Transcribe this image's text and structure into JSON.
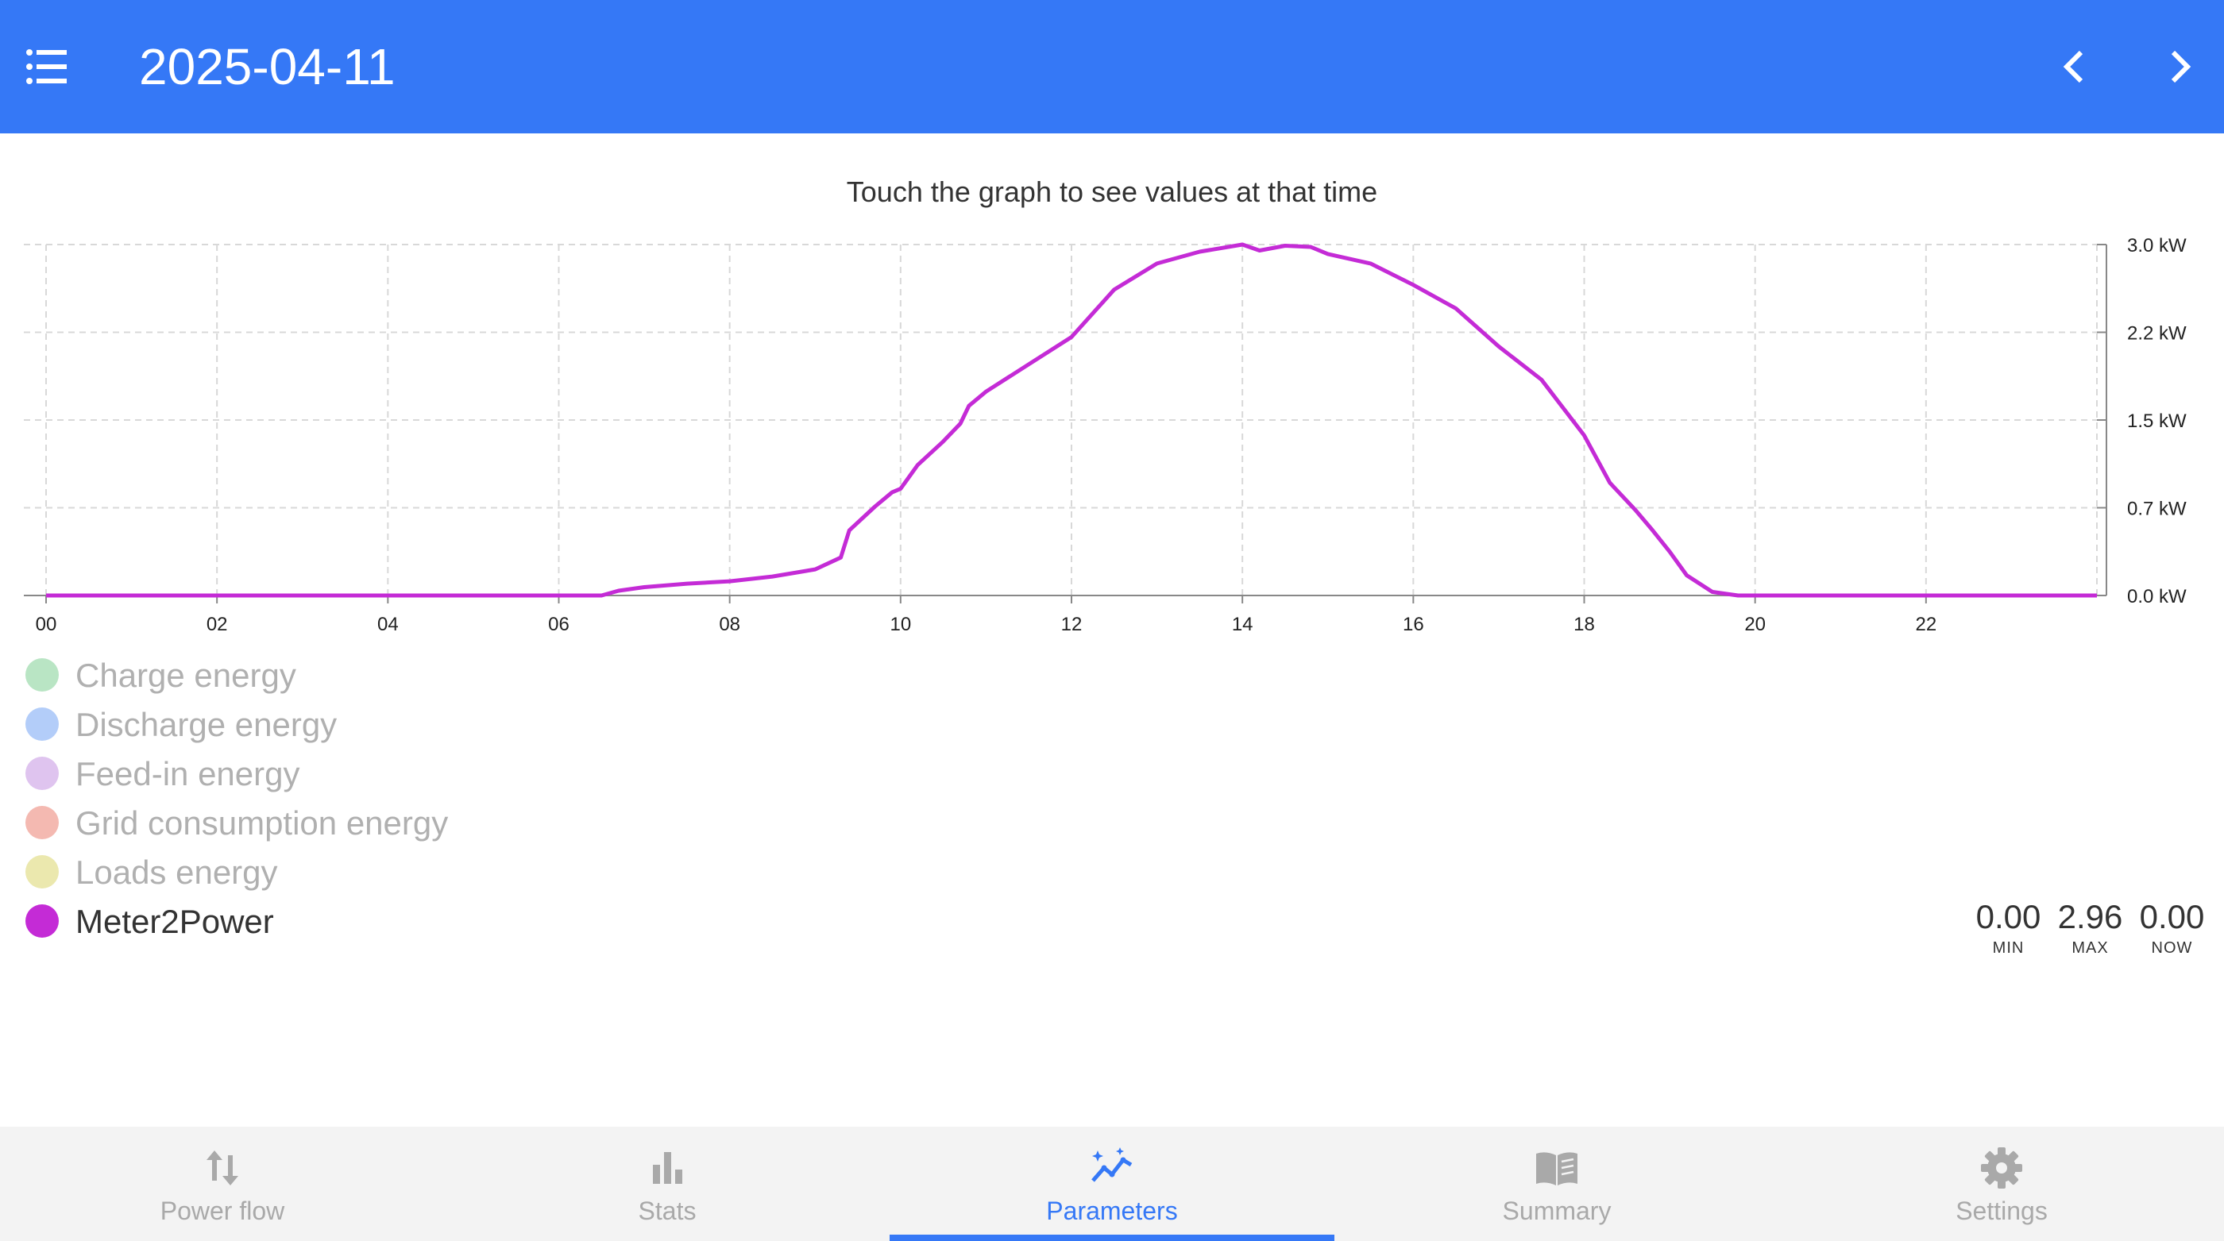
{
  "header": {
    "title": "2025-04-11",
    "menu_icon": "list-icon",
    "prev_icon": "chevron-left-icon",
    "next_icon": "chevron-right-icon",
    "background": "#3578f6"
  },
  "hint": "Touch the graph to see values at that time",
  "chart_data": {
    "type": "line",
    "x_unit": "hour of day",
    "x_ticks": [
      "00",
      "02",
      "04",
      "06",
      "08",
      "10",
      "12",
      "14",
      "16",
      "18",
      "20",
      "22"
    ],
    "y_ticks": [
      "0.0 kW",
      "0.7 kW",
      "1.5 kW",
      "2.2 kW",
      "3.0 kW"
    ],
    "ylim": [
      0,
      2.96
    ],
    "xlim": [
      0,
      24
    ],
    "grid": true,
    "series": [
      {
        "name": "Meter2Power",
        "color": "#c42bd6",
        "points": [
          [
            0,
            0.0
          ],
          [
            6.5,
            0.0
          ],
          [
            6.7,
            0.04
          ],
          [
            7.0,
            0.07
          ],
          [
            7.5,
            0.1
          ],
          [
            8.0,
            0.12
          ],
          [
            8.5,
            0.16
          ],
          [
            9.0,
            0.22
          ],
          [
            9.3,
            0.32
          ],
          [
            9.4,
            0.55
          ],
          [
            9.7,
            0.75
          ],
          [
            9.9,
            0.87
          ],
          [
            10.0,
            0.9
          ],
          [
            10.2,
            1.1
          ],
          [
            10.5,
            1.3
          ],
          [
            10.7,
            1.45
          ],
          [
            10.8,
            1.6
          ],
          [
            11.0,
            1.72
          ],
          [
            11.5,
            1.95
          ],
          [
            12.0,
            2.18
          ],
          [
            12.3,
            2.42
          ],
          [
            12.5,
            2.58
          ],
          [
            13.0,
            2.8
          ],
          [
            13.5,
            2.9
          ],
          [
            14.0,
            2.96
          ],
          [
            14.2,
            2.91
          ],
          [
            14.5,
            2.95
          ],
          [
            14.8,
            2.94
          ],
          [
            15.0,
            2.88
          ],
          [
            15.5,
            2.8
          ],
          [
            16.0,
            2.62
          ],
          [
            16.5,
            2.42
          ],
          [
            17.0,
            2.1
          ],
          [
            17.5,
            1.82
          ],
          [
            18.0,
            1.35
          ],
          [
            18.3,
            0.95
          ],
          [
            18.6,
            0.72
          ],
          [
            18.8,
            0.55
          ],
          [
            19.0,
            0.37
          ],
          [
            19.2,
            0.17
          ],
          [
            19.5,
            0.03
          ],
          [
            19.8,
            0.0
          ],
          [
            24.0,
            0.0
          ]
        ]
      }
    ]
  },
  "legend": [
    {
      "label": "Charge energy",
      "color": "#b9e5c4",
      "label_color": "#b0b0b0"
    },
    {
      "label": "Discharge energy",
      "color": "#b3cdf9",
      "label_color": "#b0b0b0"
    },
    {
      "label": "Feed-in energy",
      "color": "#dfc4ef",
      "label_color": "#b0b0b0"
    },
    {
      "label": "Grid consumption energy",
      "color": "#f4b9b1",
      "label_color": "#b0b0b0"
    },
    {
      "label": "Loads energy",
      "color": "#ebe8ae",
      "label_color": "#b0b0b0"
    },
    {
      "label": "Meter2Power",
      "color": "#c42bd6",
      "label_color": "#333333"
    }
  ],
  "stats": [
    {
      "value": "0.00",
      "caption": "MIN"
    },
    {
      "value": "2.96",
      "caption": "MAX"
    },
    {
      "value": "0.00",
      "caption": "NOW"
    }
  ],
  "tabs": [
    {
      "label": "Power flow",
      "icon": "arrows-up-down-icon",
      "active": false
    },
    {
      "label": "Stats",
      "icon": "bar-chart-icon",
      "active": false
    },
    {
      "label": "Parameters",
      "icon": "sparkle-chart-icon",
      "active": true
    },
    {
      "label": "Summary",
      "icon": "book-icon",
      "active": false
    },
    {
      "label": "Settings",
      "icon": "gear-icon",
      "active": false
    }
  ]
}
